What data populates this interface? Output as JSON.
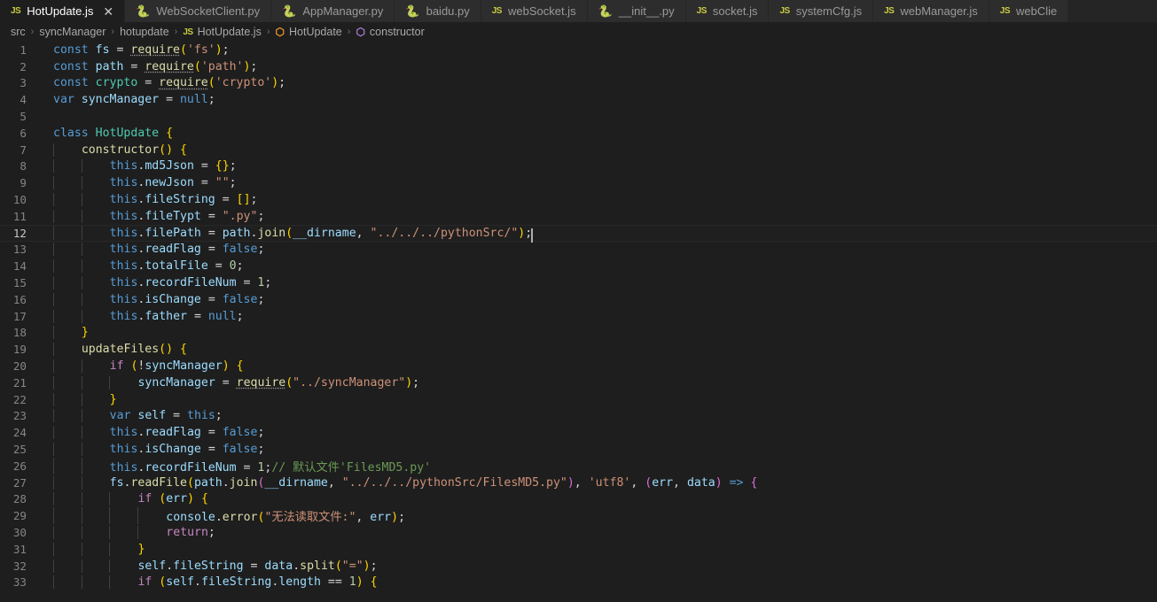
{
  "tabs": [
    {
      "label": "HotUpdate.js",
      "icon": "js-file-icon",
      "icon_kind": "js",
      "active": true,
      "closable": true,
      "close_glyph": "✕"
    },
    {
      "label": "WebSocketClient.py",
      "icon": "python-file-icon",
      "icon_kind": "py",
      "active": false,
      "closable": false
    },
    {
      "label": "AppManager.py",
      "icon": "python-file-icon",
      "icon_kind": "py",
      "active": false,
      "closable": false
    },
    {
      "label": "baidu.py",
      "icon": "python-file-icon",
      "icon_kind": "py",
      "active": false,
      "closable": false
    },
    {
      "label": "webSocket.js",
      "icon": "js-file-icon",
      "icon_kind": "js",
      "active": false,
      "closable": false
    },
    {
      "label": "__init__.py",
      "icon": "python-file-icon",
      "icon_kind": "py",
      "active": false,
      "closable": false
    },
    {
      "label": "socket.js",
      "icon": "js-file-icon",
      "icon_kind": "js",
      "active": false,
      "closable": false
    },
    {
      "label": "systemCfg.js",
      "icon": "js-file-icon",
      "icon_kind": "js",
      "active": false,
      "closable": false
    },
    {
      "label": "webManager.js",
      "icon": "js-file-icon",
      "icon_kind": "js",
      "active": false,
      "closable": false
    },
    {
      "label": "webClie",
      "icon": "js-file-icon",
      "icon_kind": "js",
      "active": false,
      "closable": false
    }
  ],
  "tab_icon_glyphs": {
    "js": "JS",
    "py": "🐍"
  },
  "breadcrumb": {
    "separator": "›",
    "items": [
      {
        "label": "src",
        "icon": null
      },
      {
        "label": "syncManager",
        "icon": null
      },
      {
        "label": "hotupdate",
        "icon": null
      },
      {
        "label": "HotUpdate.js",
        "icon": "js-file-icon",
        "icon_kind": "js",
        "icon_glyph": "JS"
      },
      {
        "label": "HotUpdate",
        "icon": "class-symbol-icon",
        "icon_kind": "cls",
        "icon_glyph": "⬡"
      },
      {
        "label": "constructor",
        "icon": "method-symbol-icon",
        "icon_kind": "method",
        "icon_glyph": "⬡"
      }
    ]
  },
  "editor": {
    "language": "javascript",
    "file": "HotUpdate.js",
    "active_line": 12,
    "cursor_line": 12,
    "first_visible_line": 1,
    "last_visible_line": 33,
    "lines": [
      {
        "n": 1,
        "text": "const fs = require('fs');"
      },
      {
        "n": 2,
        "text": "const path = require('path');"
      },
      {
        "n": 3,
        "text": "const crypto = require('crypto');"
      },
      {
        "n": 4,
        "text": "var syncManager = null;"
      },
      {
        "n": 5,
        "text": ""
      },
      {
        "n": 6,
        "text": "class HotUpdate {"
      },
      {
        "n": 7,
        "text": "    constructor() {"
      },
      {
        "n": 8,
        "text": "        this.md5Json = {};"
      },
      {
        "n": 9,
        "text": "        this.newJson = \"\";"
      },
      {
        "n": 10,
        "text": "        this.fileString = [];"
      },
      {
        "n": 11,
        "text": "        this.fileTypt = \".py\";"
      },
      {
        "n": 12,
        "text": "        this.filePath = path.join(__dirname, \"../../../pythonSrc/\");"
      },
      {
        "n": 13,
        "text": "        this.readFlag = false;"
      },
      {
        "n": 14,
        "text": "        this.totalFile = 0;"
      },
      {
        "n": 15,
        "text": "        this.recordFileNum = 1;"
      },
      {
        "n": 16,
        "text": "        this.isChange = false;"
      },
      {
        "n": 17,
        "text": "        this.father = null;"
      },
      {
        "n": 18,
        "text": "    }"
      },
      {
        "n": 19,
        "text": "    updateFiles() {"
      },
      {
        "n": 20,
        "text": "        if (!syncManager) {"
      },
      {
        "n": 21,
        "text": "            syncManager = require(\"../syncManager\");"
      },
      {
        "n": 22,
        "text": "        }"
      },
      {
        "n": 23,
        "text": "        var self = this;"
      },
      {
        "n": 24,
        "text": "        this.readFlag = false;"
      },
      {
        "n": 25,
        "text": "        this.isChange = false;"
      },
      {
        "n": 26,
        "text": "        this.recordFileNum = 1;// 默认文件'FilesMD5.py'"
      },
      {
        "n": 27,
        "text": "        fs.readFile(path.join(__dirname, \"../../../pythonSrc/FilesMD5.py\"), 'utf8', (err, data) => {"
      },
      {
        "n": 28,
        "text": "            if (err) {"
      },
      {
        "n": 29,
        "text": "                console.error(\"无法读取文件:\", err);"
      },
      {
        "n": 30,
        "text": "                return;"
      },
      {
        "n": 31,
        "text": "            }"
      },
      {
        "n": 32,
        "text": "            self.fileString = data.split(\"=\");"
      },
      {
        "n": 33,
        "text": "            if (self.fileString.length == 1) {"
      }
    ]
  },
  "colors": {
    "editor_background": "#1e1e1e",
    "tabbar_background": "#252526",
    "inactive_tab_background": "#2d2d2d",
    "active_tab_background": "#1e1e1e",
    "line_number": "#858585",
    "active_line_number": "#c6c6c6",
    "keyword": "#569cd6",
    "control_keyword": "#c586c0",
    "function": "#dcdcaa",
    "string": "#ce9178",
    "number": "#b5cea8",
    "variable": "#9cdcfe",
    "type": "#4ec9b0",
    "comment": "#6a9955",
    "bracket_yellow": "#ffd700",
    "bracket_pink": "#da70d6",
    "bracket_blue": "#179fff",
    "cursor": "#aeafad",
    "js_icon": "#cbcb41",
    "py_icon": "#519aba",
    "class_icon": "#ee9d28",
    "method_icon": "#b180d7"
  }
}
